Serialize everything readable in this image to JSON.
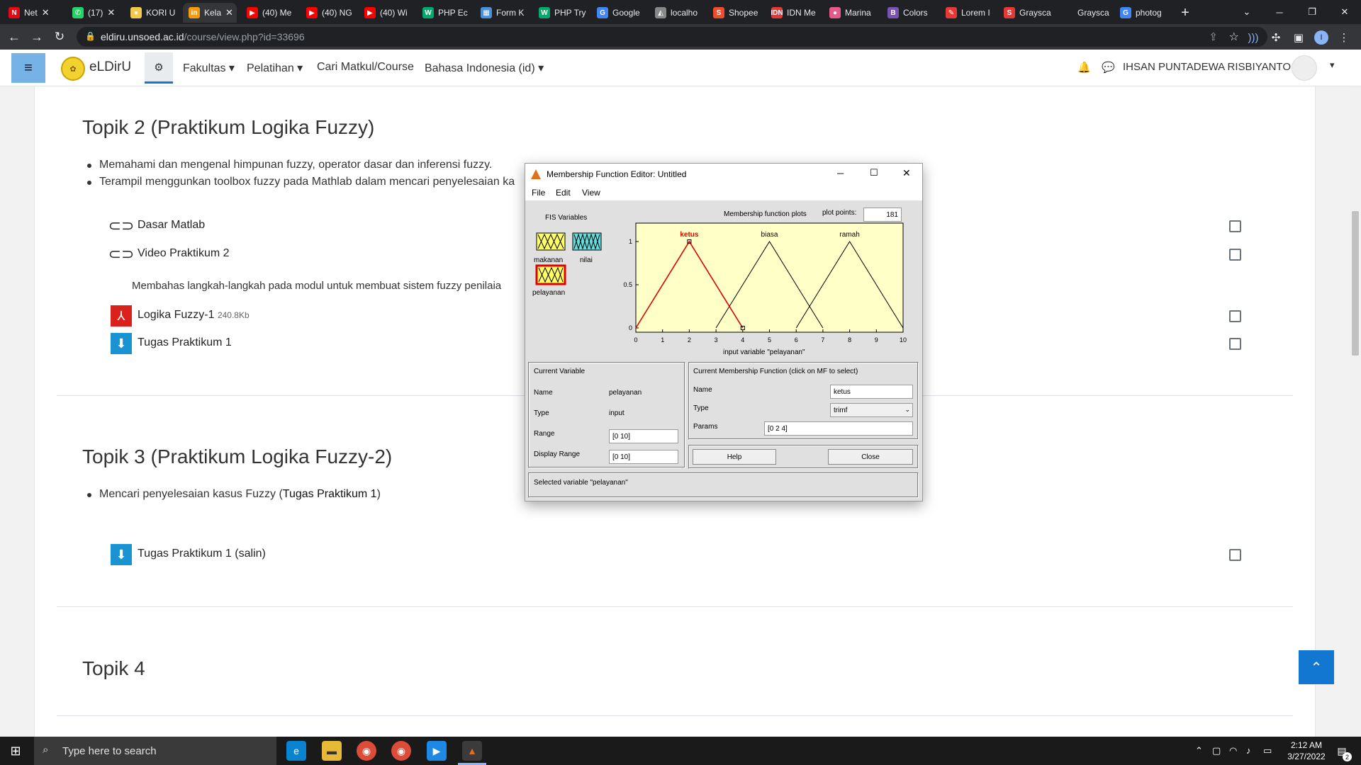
{
  "browser": {
    "tabs": [
      {
        "label": "Net",
        "favicon": "N",
        "color": "#e50914",
        "x": 4,
        "w": 84
      },
      {
        "label": "(17)",
        "favicon": "✆",
        "color": "#25d366",
        "x": 94,
        "w": 76
      },
      {
        "label": "KORI U",
        "favicon": "●",
        "color": "#f2c94c",
        "x": 176,
        "w": 76
      },
      {
        "label": "Kela",
        "favicon": "in",
        "color": "#f39c12",
        "x": 258,
        "w": 76,
        "active": true
      },
      {
        "label": "(40) Me",
        "favicon": "▶",
        "color": "#ff0000",
        "x": 340,
        "w": 80
      },
      {
        "label": "(40) NG",
        "favicon": "▶",
        "color": "#ff0000",
        "x": 424,
        "w": 80
      },
      {
        "label": "(40) Wi",
        "favicon": "▶",
        "color": "#ff0000",
        "x": 506,
        "w": 80
      },
      {
        "label": "PHP Ec",
        "favicon": "W",
        "color": "#04aa6d",
        "x": 588,
        "w": 80
      },
      {
        "label": "Form K",
        "favicon": "▦",
        "color": "#4a90d9",
        "x": 670,
        "w": 80
      },
      {
        "label": "PHP Try",
        "favicon": "W",
        "color": "#04aa6d",
        "x": 752,
        "w": 80
      },
      {
        "label": "Google",
        "favicon": "G",
        "color": "#4285f4",
        "x": 834,
        "w": 80
      },
      {
        "label": "localho",
        "favicon": "◭",
        "color": "#888",
        "x": 916,
        "w": 80
      },
      {
        "label": "Shopee",
        "favicon": "S",
        "color": "#ee4d2d",
        "x": 998,
        "w": 80
      },
      {
        "label": "IDN Me",
        "favicon": "IDN",
        "color": "#e53935",
        "x": 1080,
        "w": 80
      },
      {
        "label": "Marina",
        "favicon": "●",
        "color": "#e85a8a",
        "x": 1162,
        "w": 80
      },
      {
        "label": "Colors",
        "favicon": "B",
        "color": "#7952b3",
        "x": 1244,
        "w": 80
      },
      {
        "label": "Lorem I",
        "favicon": "✎",
        "color": "#e53935",
        "x": 1326,
        "w": 80
      },
      {
        "label": "Graysca",
        "favicon": "S",
        "color": "#e53935",
        "x": 1408,
        "w": 80
      },
      {
        "label": "Graysca",
        "favicon": "",
        "color": "#202124",
        "x": 1490,
        "w": 80
      },
      {
        "label": "photog",
        "favicon": "G",
        "color": "#4285f4",
        "x": 1572,
        "w": 80
      }
    ],
    "new_tab": "+",
    "url_host": "eldiru.unsoed.ac.id",
    "url_path": "/course/view.php?id=33696"
  },
  "site": {
    "brand": "eLDirU",
    "nav": [
      "Fakultas",
      "Pelatihan",
      "Cari Matkul/Course",
      "Bahasa Indonesia (id)"
    ],
    "user": "IHSAN PUNTADEWA RISBIYANTO"
  },
  "course": {
    "topic2": {
      "title": "Topik 2 (Praktikum Logika Fuzzy)",
      "bullets": [
        "Memahami dan mengenal himpunan fuzzy, operator dasar dan inferensi fuzzy.",
        "Terampil menggunkan toolbox fuzzy pada Mathlab dalam mencari penyelesaian ka"
      ],
      "a1": "Dasar Matlab",
      "a2": "Video Praktikum 2",
      "a2_desc": "Membahas langkah-langkah pada modul untuk membuat sistem fuzzy penilaia",
      "a3": "Logika Fuzzy-1",
      "a3_size": "240.8Kb",
      "a4": "Tugas Praktikum 1"
    },
    "topic3": {
      "title": "Topik 3 (Praktikum Logika Fuzzy-2)",
      "bullet_pre": "Mencari penyelesaian kasus Fuzzy (",
      "bullet_bold": "Tugas Praktikum 1",
      "bullet_post": ")",
      "a1": "Tugas Praktikum 1 (salin)"
    },
    "topic4": {
      "title": "Topik 4"
    }
  },
  "mf_editor": {
    "title": "Membership Function Editor: Untitled",
    "menu": [
      "File",
      "Edit",
      "View"
    ],
    "fis_label": "FIS Variables",
    "vars": [
      "makanan",
      "nilai",
      "pelayanan"
    ],
    "plot_title": "Membership function plots",
    "plot_points_label": "plot points:",
    "plot_points": "181",
    "axis_label": "input variable \"pelayanan\"",
    "y_ticks": [
      "1",
      "0.5",
      "0"
    ],
    "x_ticks": [
      "0",
      "1",
      "2",
      "3",
      "4",
      "5",
      "6",
      "7",
      "8",
      "9",
      "10"
    ],
    "current_variable": {
      "header": "Current Variable",
      "name_label": "Name",
      "name": "pelayanan",
      "type_label": "Type",
      "type": "input",
      "range_label": "Range",
      "range": "[0 10]",
      "display_range_label": "Display Range",
      "display_range": "[0 10]"
    },
    "current_mf": {
      "header": "Current Membership Function (click on MF to select)",
      "name_label": "Name",
      "name": "ketus",
      "type_label": "Type",
      "type": "trimf",
      "params_label": "Params",
      "params": "[0 2 4]"
    },
    "help": "Help",
    "close": "Close",
    "status": "Selected variable \"pelayanan\""
  },
  "chart_data": {
    "type": "line",
    "xlim": [
      0,
      10
    ],
    "ylim": [
      0,
      1
    ],
    "series": [
      {
        "name": "ketus",
        "x": [
          0,
          2,
          4
        ],
        "y": [
          0,
          1,
          0
        ],
        "color": "#e00000"
      },
      {
        "name": "biasa",
        "x": [
          3,
          5,
          7
        ],
        "y": [
          0,
          1,
          0
        ],
        "color": "#000000"
      },
      {
        "name": "ramah",
        "x": [
          6,
          8,
          10
        ],
        "y": [
          0,
          1,
          0
        ],
        "color": "#000000"
      }
    ]
  },
  "taskbar": {
    "search": "Type here to search",
    "time": "2:12 AM",
    "date": "3/27/2022",
    "notif": "2"
  }
}
